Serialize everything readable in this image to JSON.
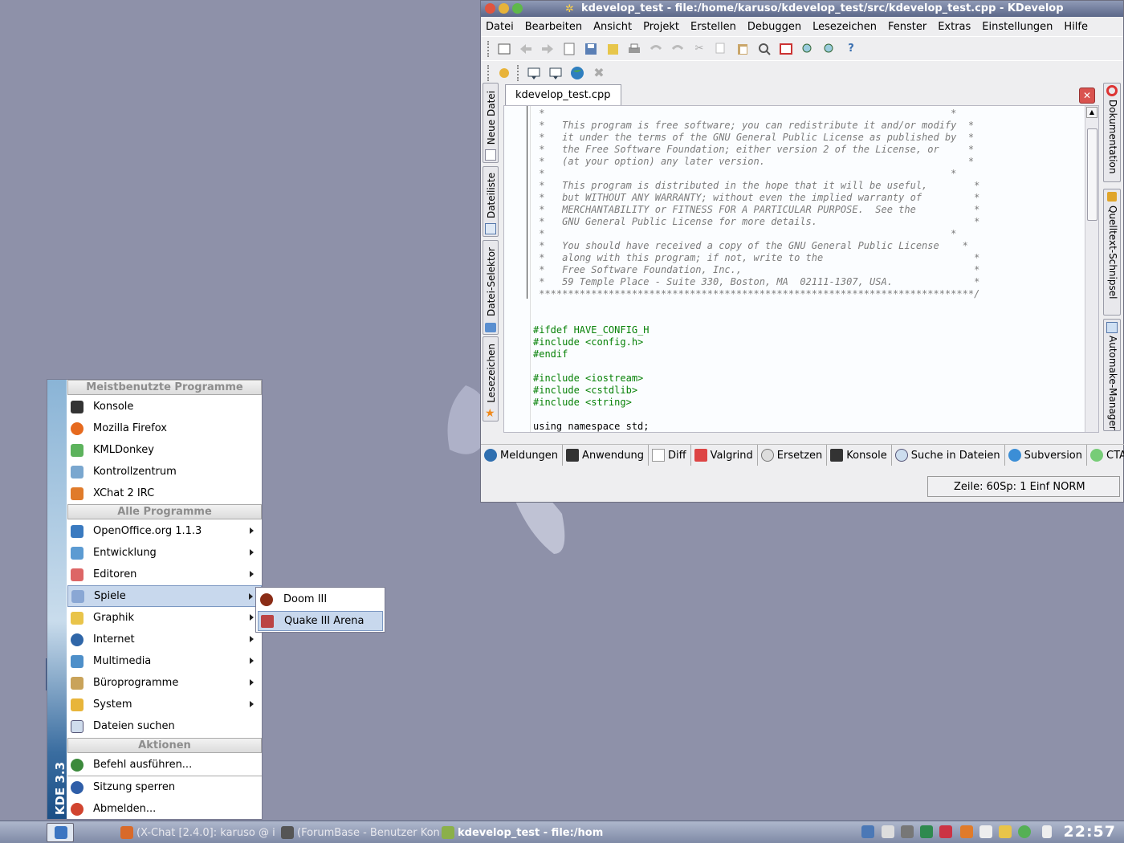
{
  "window": {
    "title": "kdevelop_test - file:/home/karuso/kdevelop_test/src/kdevelop_test.cpp - KDevelop",
    "menu": [
      "Datei",
      "Bearbeiten",
      "Ansicht",
      "Projekt",
      "Erstellen",
      "Debuggen",
      "Lesezeichen",
      "Fenster",
      "Extras",
      "Einstellungen",
      "Hilfe"
    ],
    "left_dock_tabs": [
      "Neue Datei",
      "Dateiliste",
      "Datei-Selektor",
      "Lesezeichen"
    ],
    "right_dock_tabs": [
      "Dokumentation",
      "Quelltext-Schnipsel",
      "Automake-Manager"
    ],
    "editor_tab": "kdevelop_test.cpp",
    "code_lines": [
      {
        "t": " *                                                                      *",
        "c": "cm"
      },
      {
        "t": " *   This program is free software; you can redistribute it and/or modify  *",
        "c": "cm"
      },
      {
        "t": " *   it under the terms of the GNU General Public License as published by  *",
        "c": "cm"
      },
      {
        "t": " *   the Free Software Foundation; either version 2 of the License, or     *",
        "c": "cm"
      },
      {
        "t": " *   (at your option) any later version.                                   *",
        "c": "cm"
      },
      {
        "t": " *                                                                      *",
        "c": "cm"
      },
      {
        "t": " *   This program is distributed in the hope that it will be useful,        *",
        "c": "cm"
      },
      {
        "t": " *   but WITHOUT ANY WARRANTY; without even the implied warranty of         *",
        "c": "cm"
      },
      {
        "t": " *   MERCHANTABILITY or FITNESS FOR A PARTICULAR PURPOSE.  See the          *",
        "c": "cm"
      },
      {
        "t": " *   GNU General Public License for more details.                           *",
        "c": "cm"
      },
      {
        "t": " *                                                                      *",
        "c": "cm"
      },
      {
        "t": " *   You should have received a copy of the GNU General Public License    *",
        "c": "cm"
      },
      {
        "t": " *   along with this program; if not, write to the                          *",
        "c": "cm"
      },
      {
        "t": " *   Free Software Foundation, Inc.,                                        *",
        "c": "cm"
      },
      {
        "t": " *   59 Temple Place - Suite 330, Boston, MA  02111-1307, USA.              *",
        "c": "cm"
      },
      {
        "t": " ***************************************************************************/",
        "c": "cm"
      },
      {
        "t": "",
        "c": ""
      },
      {
        "t": "",
        "c": ""
      },
      {
        "t": "#ifdef HAVE_CONFIG_H",
        "c": "pp"
      },
      {
        "t": "#include <config.h>",
        "c": "pp"
      },
      {
        "t": "#endif",
        "c": "pp"
      },
      {
        "t": "",
        "c": ""
      },
      {
        "t": "#include <iostream>",
        "c": "pp"
      },
      {
        "t": "#include <cstdlib>",
        "c": "pp"
      },
      {
        "t": "#include <string>",
        "c": "pp"
      },
      {
        "t": "",
        "c": ""
      },
      {
        "t": "using namespace std;",
        "c": ""
      }
    ],
    "bottom_tabs": [
      "Meldungen",
      "Anwendung",
      "Diff",
      "Valgrind",
      "Ersetzen",
      "Konsole",
      "Suche in Dateien",
      "Subversion",
      "CTAGS"
    ],
    "status": "Zeile: 60Sp: 1  Einf NORM"
  },
  "kmenu": {
    "side_title": "KDE 3.3",
    "sections": {
      "most_used": "Meistbenutzte Programme",
      "all": "Alle Programme",
      "actions": "Aktionen"
    },
    "most_used": [
      "Konsole",
      "Mozilla Firefox",
      "KMLDonkey",
      "Kontrollzentrum",
      "XChat 2 IRC"
    ],
    "all_programs": [
      "OpenOffice.org 1.1.3",
      "Entwicklung",
      "Editoren",
      "Spiele",
      "Graphik",
      "Internet",
      "Multimedia",
      "Büroprogramme",
      "System"
    ],
    "find": "Dateien suchen",
    "actions": [
      "Befehl ausführen...",
      "Sitzung sperren",
      "Abmelden..."
    ]
  },
  "submenu": [
    "Doom III",
    "Quake III Arena"
  ],
  "taskbar": {
    "tasks": [
      "(X-Chat [2.4.0]: karuso @ i",
      "(ForumBase - Benutzer Kon",
      "kdevelop_test - file:/hom"
    ],
    "clock": "22:57"
  }
}
